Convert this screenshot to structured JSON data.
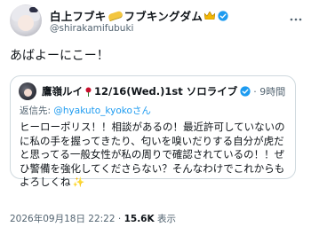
{
  "tweet": {
    "author_name": "白上フブキ",
    "author_name_suffix": "フブキングダム",
    "author_handle": "@shirakamifubuki",
    "text": "あばよーにこー！",
    "more_icon": "more-horizontal-icon",
    "verified_color": "#1d9bf0"
  },
  "quoted": {
    "author_name": "鷹嶺ルイ",
    "author_name_suffix": "12/16(Wed.)1st ソロライブ",
    "time": "· 9時間",
    "reply_prefix": "返信先: ",
    "reply_mention": "@hyakuto_kyokoさん",
    "text": "ヒーローポリス！！相談があるの！最近許可していないのに私の手を握ってきたり、匂いを嗅いだりする自分が虎だと思ってる一般女性が私の周りで確認されているの！！ぜひ警備を強化してくださらない？そんなわけでこれからもよろしくね",
    "sparkle": "✨"
  },
  "footer": {
    "datetime": "2026年09月18日 22:22",
    "separator": "·",
    "views_count": "15.6K",
    "views_label": "表示"
  }
}
